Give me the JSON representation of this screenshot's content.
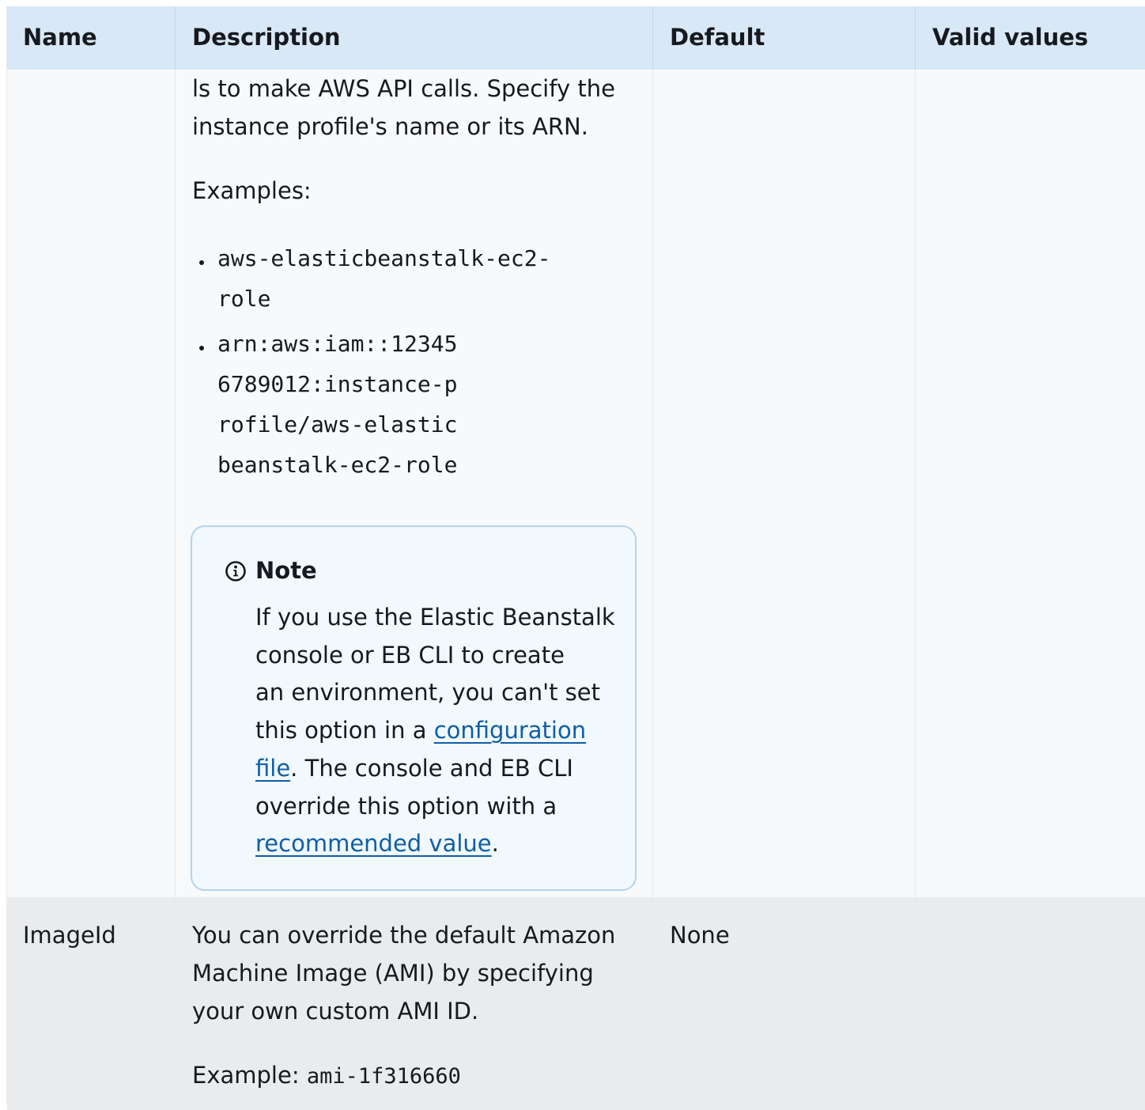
{
  "table": {
    "headers": {
      "name": "Name",
      "description": "Description",
      "default": "Default",
      "valid_values": "Valid values"
    },
    "row1": {
      "description_line1": "ls to make AWS API calls. Specify the",
      "description_line2": "instance profile's name or its ARN.",
      "examples_label": "Examples:",
      "example1_line1": "aws-elasticbeanstalk-ec2-",
      "example1_line2": "role",
      "example2_line1": "arn:aws:iam::12345",
      "example2_line2": "6789012:instance-p",
      "example2_line3": "rofile/aws-elastic",
      "example2_line4": "beanstalk-ec2-role",
      "note": {
        "title": "Note",
        "line1": "If you use the Elastic Beanstalk",
        "line2": "console or EB CLI to create",
        "line3": "an environment, you can't set",
        "line4_prefix": "this option in a ",
        "link_configuration": "configuration",
        "link_file": "file",
        "line5_suffix": ". The console and EB CLI",
        "line6": "override this option with a",
        "link_recommended": "recommended value",
        "line7_suffix": "."
      }
    },
    "row2": {
      "name": "ImageId",
      "description_line1": "You can override the default Amazon",
      "description_line2": "Machine Image (AMI) by specifying",
      "description_line3": "your own custom AMI ID.",
      "example_label": "Example: ",
      "example_value": "ami-1f316660",
      "default": "None"
    }
  }
}
